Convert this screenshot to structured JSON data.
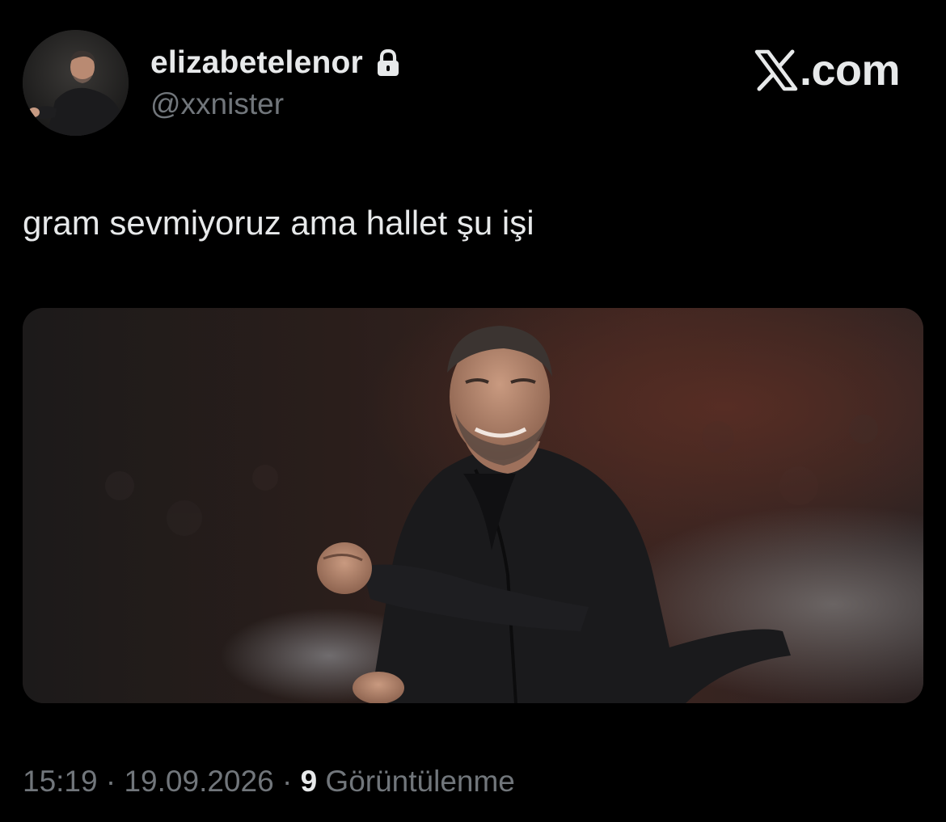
{
  "tweet": {
    "display_name": "elizabetelenor",
    "handle": "@xxnister",
    "protected_icon": "lock-icon",
    "text": "gram sevmiyoruz ama hallet şu işi",
    "time": "15:19",
    "separator_1": " · ",
    "date": "19.09.2026",
    "separator_2": " · ",
    "views_count": "9",
    "views_label": " Görüntülenme"
  },
  "brand": {
    "logo_icon": "x-logo-icon",
    "text": ".com"
  },
  "colors": {
    "background": "#000000",
    "primary_text": "#e7e9ea",
    "secondary_text": "#71767b"
  }
}
